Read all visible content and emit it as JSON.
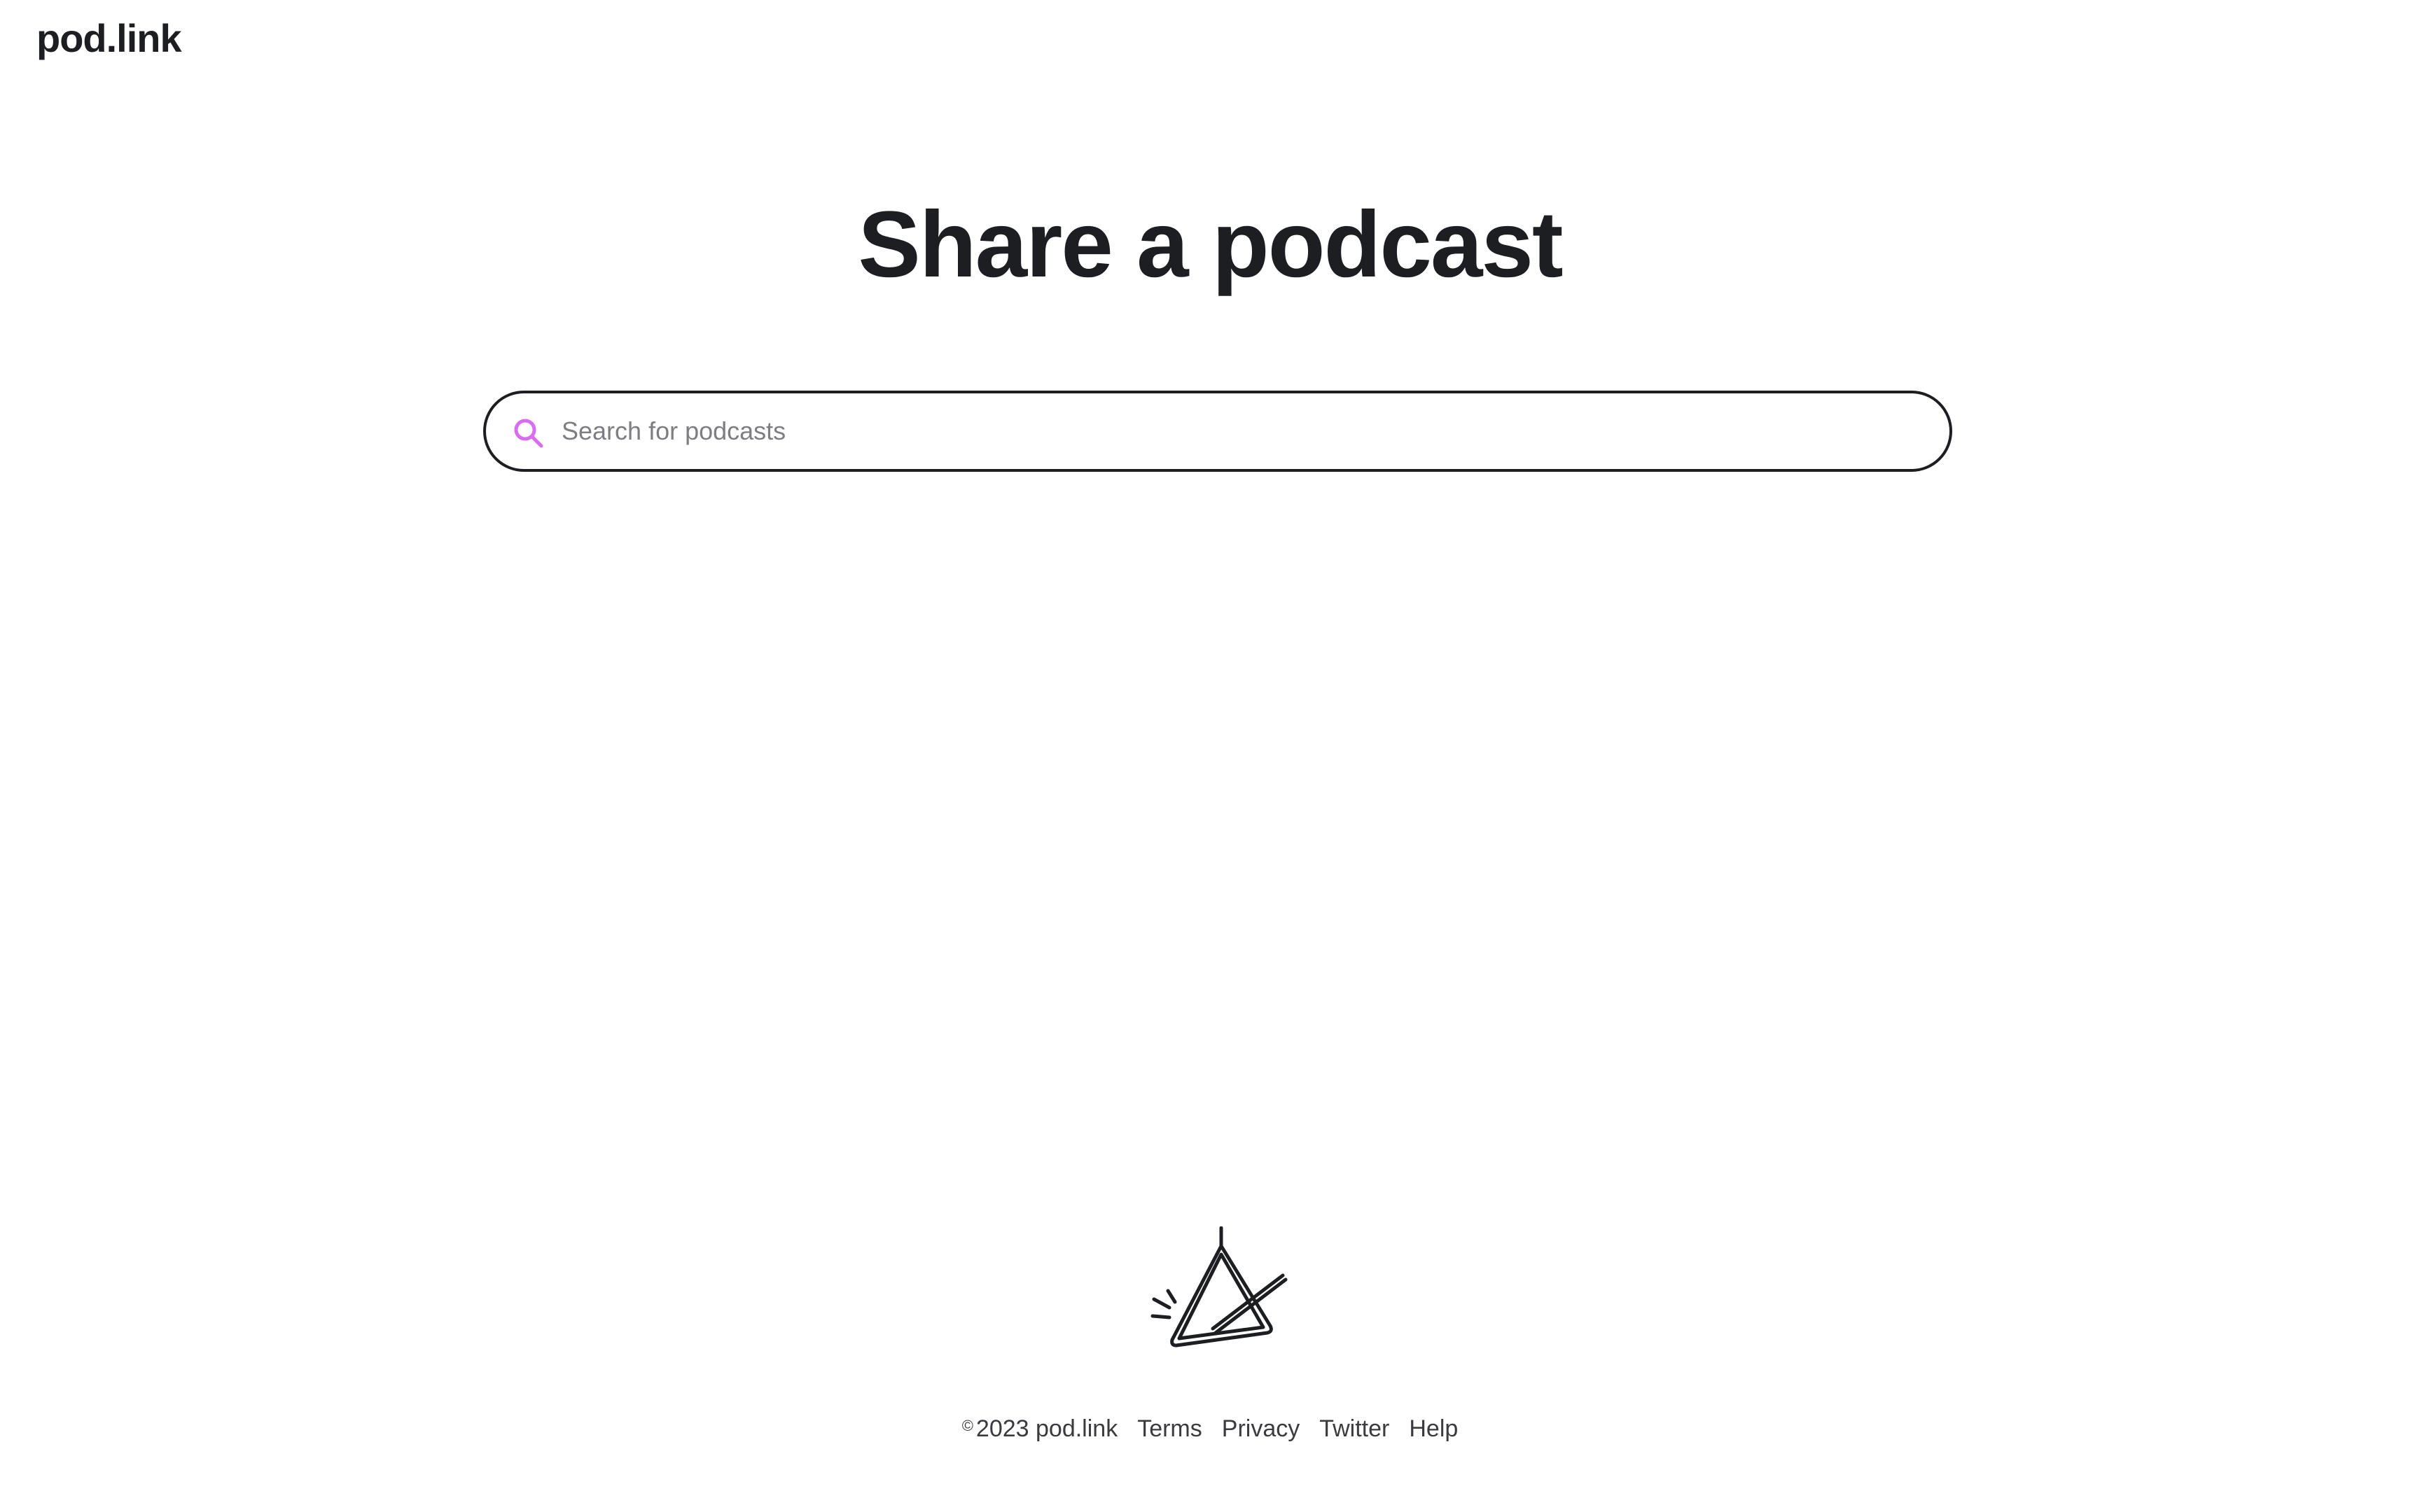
{
  "header": {
    "logo_text": "pod.link"
  },
  "hero": {
    "title": "Share a podcast"
  },
  "search": {
    "placeholder": "Search for podcasts",
    "icon": "search-icon",
    "icon_color": "#d96cf0"
  },
  "footer": {
    "copyright_symbol": "©",
    "copyright_text": "2023 pod.link",
    "links": [
      "Terms",
      "Privacy",
      "Twitter",
      "Help"
    ],
    "icon": "triangle-instrument-icon"
  },
  "colors": {
    "text": "#1d1e22",
    "accent": "#d96cf0",
    "muted": "#7d7e83"
  }
}
